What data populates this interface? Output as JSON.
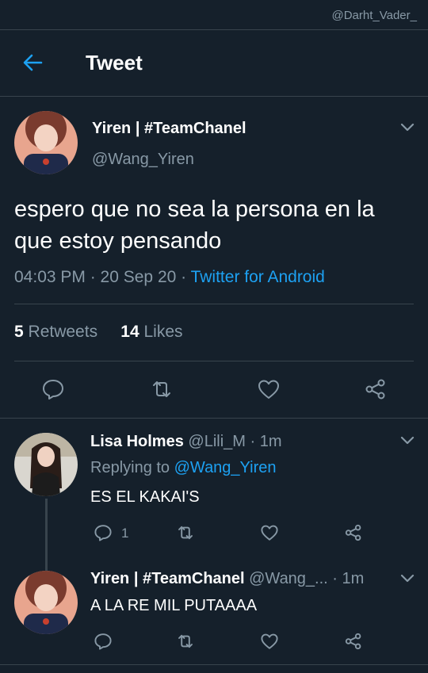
{
  "watermark": "@Darht_Vader_",
  "header": {
    "title": "Tweet"
  },
  "tweet": {
    "name": "Yiren | #TeamChanel",
    "handle": "@Wang_Yiren",
    "text": "espero que no sea la persona en la que estoy pensando",
    "time": "04:03 PM · 20 Sep 20 · ",
    "source": "Twitter for Android",
    "retweet_count": "5",
    "retweet_label": "Retweets",
    "like_count": "14",
    "like_label": "Likes"
  },
  "replies": [
    {
      "name": "Lisa Holmes",
      "handle_time": "@Lili_M · 1m",
      "replying_prefix": "Replying to ",
      "replying_to": "@Wang_Yiren",
      "text": "ES EL KAKAI'S",
      "reply_count": "1"
    },
    {
      "name": "Yiren | #TeamChanel",
      "handle_time": "@Wang_... · 1m",
      "text": "A LA RE MIL PUTAAAA"
    }
  ],
  "colors": {
    "background": "#15202b",
    "accent": "#1da1f2",
    "muted": "#8899a6",
    "divider": "#38444d"
  }
}
